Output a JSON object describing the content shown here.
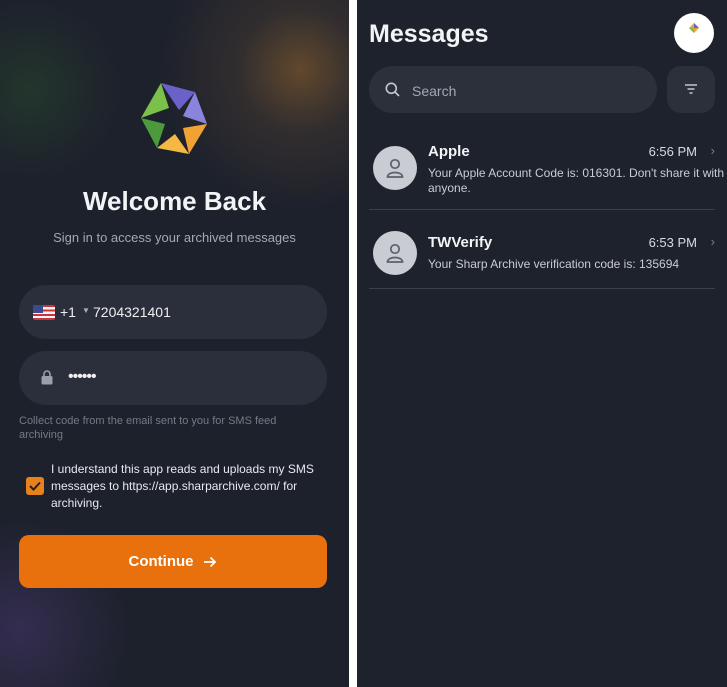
{
  "login": {
    "title": "Welcome Back",
    "subtitle": "Sign in to access your archived messages",
    "phone": {
      "flag": "us-flag",
      "country_code": "+1",
      "value": "7204321401"
    },
    "password": {
      "value": "••••••",
      "icon": "lock-icon"
    },
    "hint": "Collect code from the email sent to you for SMS feed archiving",
    "consent": {
      "checked": true,
      "text": "I understand this app reads and uploads my SMS messages to https://app.sharparchive.com/ for archiving."
    },
    "continue_label": "Continue",
    "colors": {
      "accent": "#e8700d",
      "checkbox": "#e8801c"
    }
  },
  "messages": {
    "title": "Messages",
    "search": {
      "placeholder": "Search"
    },
    "conversations": [
      {
        "sender": "Apple",
        "time": "6:56 PM",
        "preview": "Your Apple Account Code is: 016301. Don't share it with anyone."
      },
      {
        "sender": "TWVerify",
        "time": "6:53 PM",
        "preview": "Your Sharp Archive verification code is: 135694"
      }
    ]
  }
}
